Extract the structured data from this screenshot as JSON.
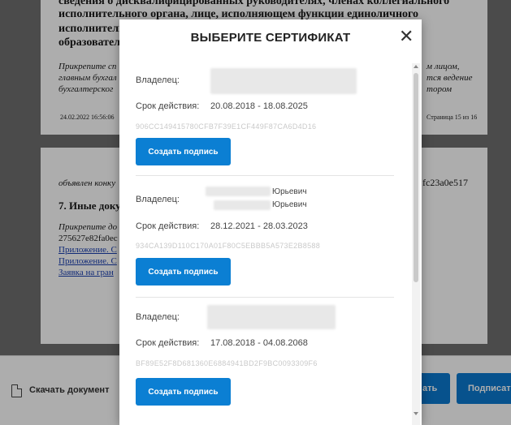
{
  "document": {
    "section1": {
      "line1": "сведения о дисквалифицированных руководителях, членах коллегиального",
      "line2": "исполнительного органа, лице, исполняющем функции единоличного",
      "line3": "исполнительн",
      "line4": "образовател",
      "note1": "Прикрепите сп",
      "note2": "главным бухгал",
      "note3": "бухгалтерског",
      "note_r1": "м лицом,",
      "note_r2": "тся ведение",
      "note_r3": "тором",
      "stamp": "24.02.2022 16:56:06",
      "page": "Страница 15 из 16"
    },
    "section2": {
      "text1": "объявлен конку",
      "hash_r": "fc23a0e517",
      "heading": "7. Иные доку",
      "note": "Прикрепите до",
      "hash": "275627e82fa0ec",
      "link1": "Приложение. С",
      "link2": "Приложение. С",
      "link3": "Заявка на гран"
    }
  },
  "footer": {
    "download_label": "Скачать документ",
    "btn1_label": "ать",
    "btn2_label": "Подписат"
  },
  "modal": {
    "title": "ВЫБЕРИТЕ СЕРТИФИКАТ",
    "close_icon": "close-icon",
    "certificates": [
      {
        "owner_label": "Владелец:",
        "owner_value": "",
        "validity_label": "Срок действия:",
        "validity_value": "20.08.2018 - 18.08.2025",
        "thumbprint": "906CC149415780CFB7F39E1CF449F87CA6D4D16",
        "button": "Создать подпись"
      },
      {
        "owner_label": "Владелец:",
        "owner_line1": "Юрьевич",
        "owner_line2": "Юрьевич",
        "validity_label": "Срок действия:",
        "validity_value": "28.12.2021 - 28.03.2023",
        "thumbprint": "934CA139D110C170A01F80C5EBBB5A573E2B8588",
        "button": "Создать подпись"
      },
      {
        "owner_label": "Владелец:",
        "owner_value": "",
        "validity_label": "Срок действия:",
        "validity_value": "17.08.2018 - 04.08.2068",
        "thumbprint": "BF89E52F8D681360E6884941BD2F9BC0093309F6",
        "button": "Создать подпись"
      }
    ]
  },
  "colors": {
    "primary_button": "#0b7fd3",
    "overlay": "rgba(0,0,0,0.32)",
    "link": "#1a3fb0"
  }
}
